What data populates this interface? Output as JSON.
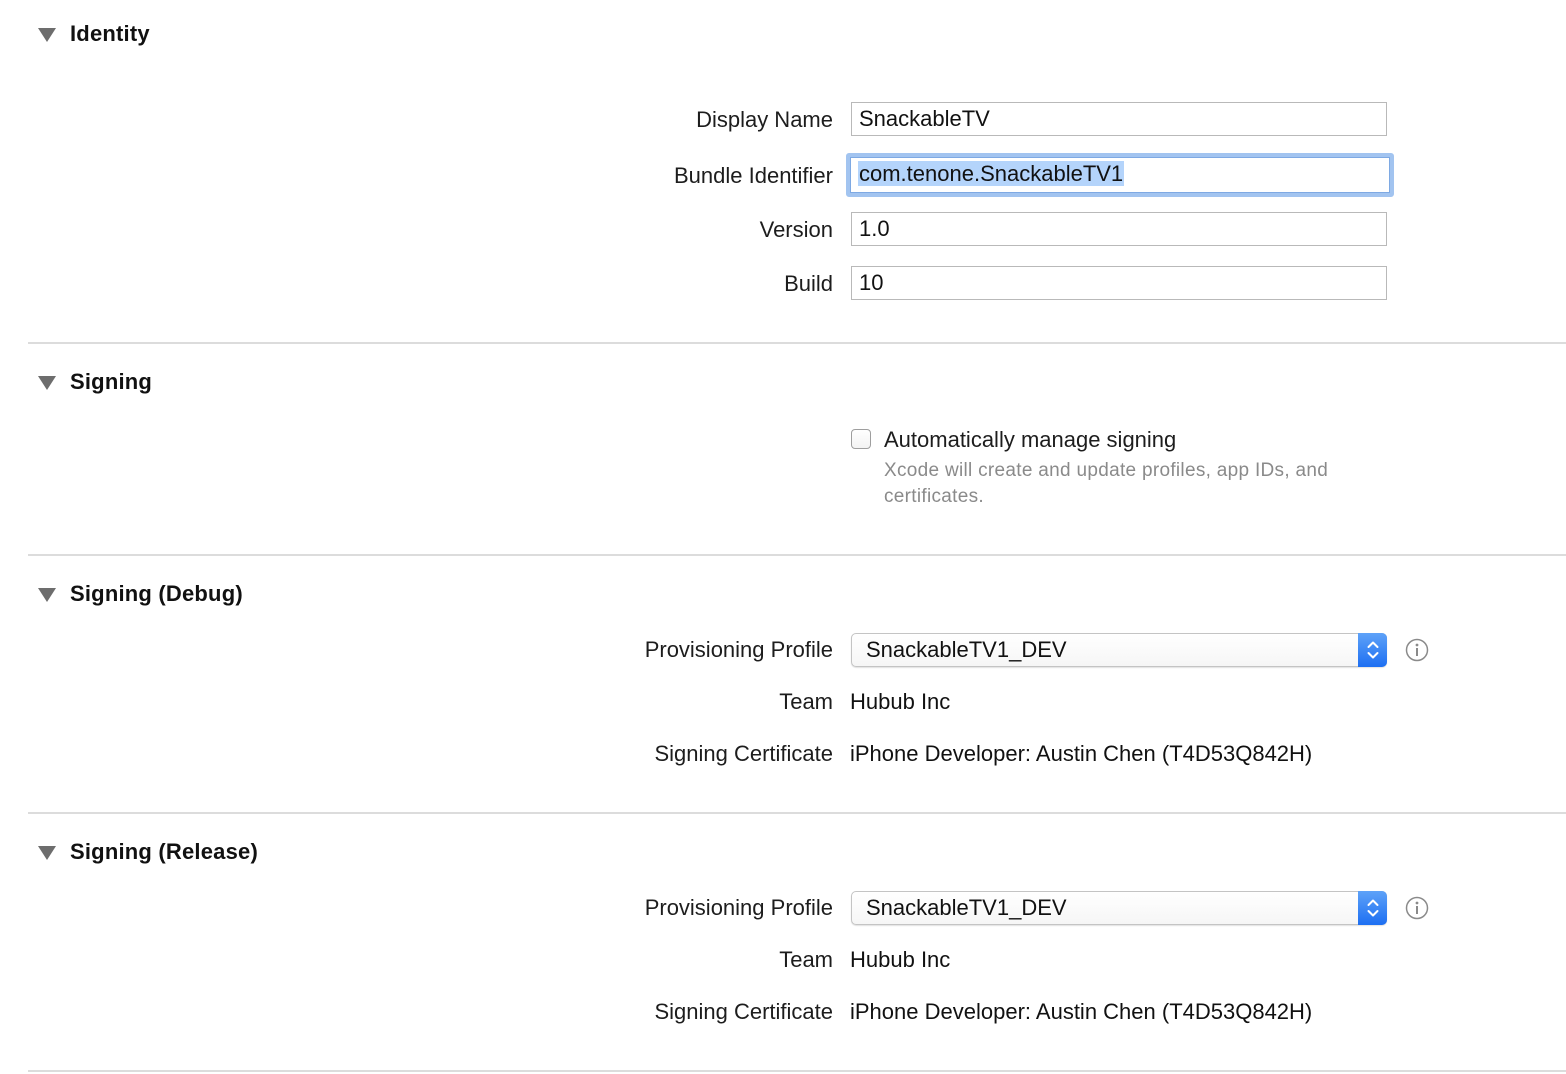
{
  "identity": {
    "title": "Identity",
    "display_name_label": "Display Name",
    "display_name_value": "SnackableTV",
    "bundle_id_label": "Bundle Identifier",
    "bundle_id_value": "com.tenone.SnackableTV1",
    "version_label": "Version",
    "version_value": "1.0",
    "build_label": "Build",
    "build_value": "10"
  },
  "signing": {
    "title": "Signing",
    "auto_manage_label": "Automatically manage signing",
    "auto_manage_checked": false,
    "auto_manage_help": "Xcode will create and update profiles, app IDs, and certificates."
  },
  "signing_debug": {
    "title": "Signing (Debug)",
    "profile_label": "Provisioning Profile",
    "profile_value": "SnackableTV1_DEV",
    "team_label": "Team",
    "team_value": "Hubub Inc",
    "certificate_label": "Signing Certificate",
    "certificate_value": "iPhone Developer: Austin Chen (T4D53Q842H)"
  },
  "signing_release": {
    "title": "Signing (Release)",
    "profile_label": "Provisioning Profile",
    "profile_value": "SnackableTV1_DEV",
    "team_label": "Team",
    "team_value": "Hubub Inc",
    "certificate_label": "Signing Certificate",
    "certificate_value": "iPhone Developer: Austin Chen (T4D53Q842H)"
  },
  "colors": {
    "focus_ring": "#a2c4f0",
    "selection": "#b4d4fb",
    "popup_accent": "#1d6ff2",
    "divider": "#dcdcdc"
  },
  "icons": {
    "disclosure": "disclosure-triangle-icon",
    "info": "info-icon",
    "popup": "up-down-chevron-icon"
  }
}
